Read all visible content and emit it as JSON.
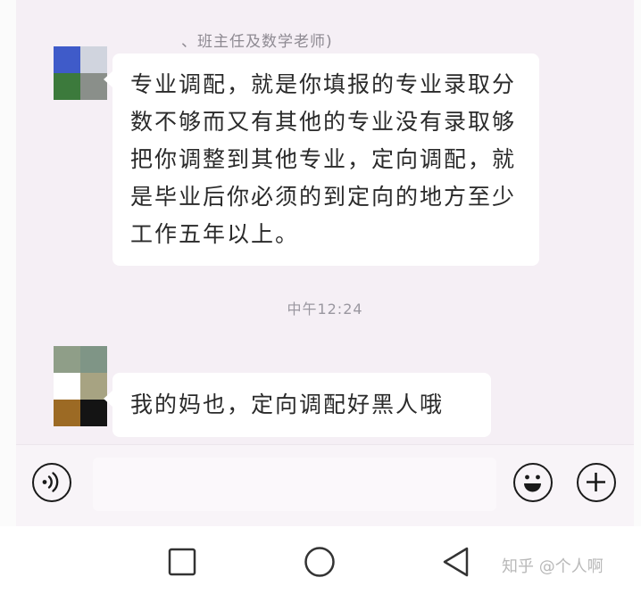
{
  "chat": {
    "sender_name": "、班主任及数学老师)",
    "messages": [
      {
        "text": "专业调配，就是你填报的专业录取分数不够而又有其他的专业没有录取够把你调整到其他专业，定向调配，就是毕业后你必须的到定向的地方至少工作五年以上。"
      },
      {
        "text": "我的妈也，定向调配好黑人哦"
      }
    ],
    "timestamp": "中午12:24"
  },
  "input_bar": {
    "voice_icon": "voice-icon",
    "emoji_icon": "emoji-icon",
    "plus_icon": "plus-icon"
  },
  "nav_bar": {
    "recent_icon": "square-icon",
    "home_icon": "circle-icon",
    "back_icon": "triangle-back-icon"
  },
  "watermark": "知乎 @个人啊"
}
